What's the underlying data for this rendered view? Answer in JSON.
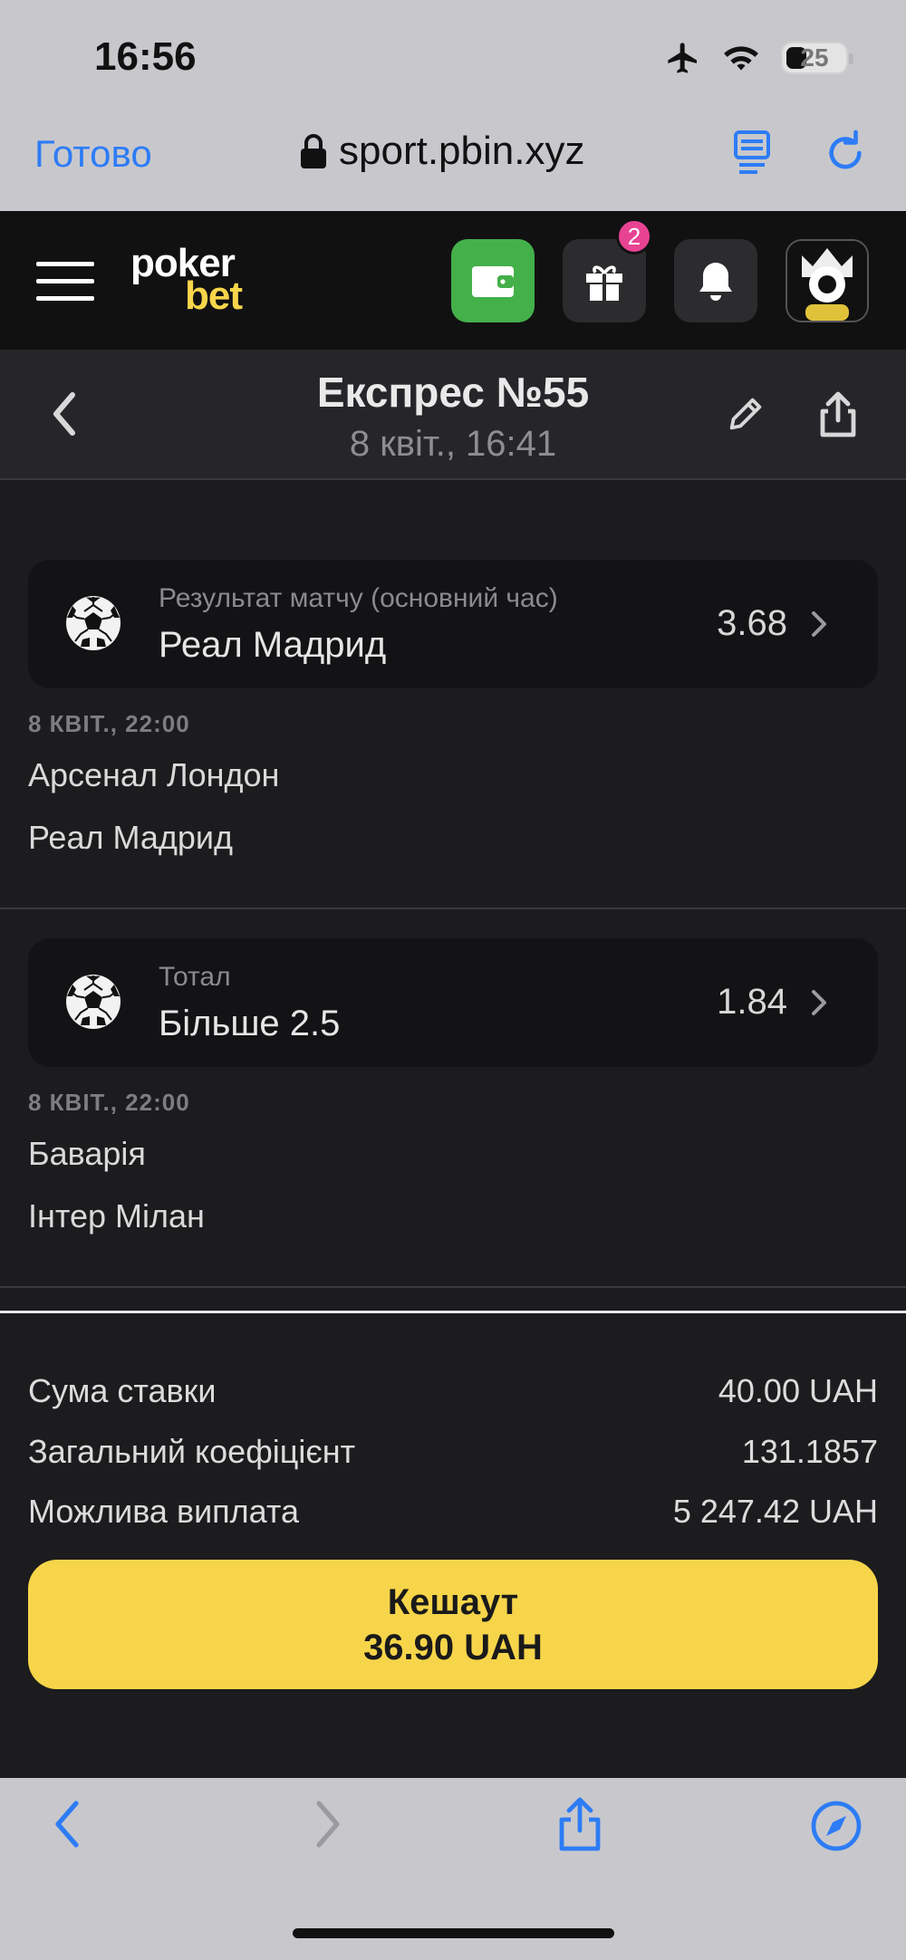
{
  "status": {
    "time": "16:56",
    "battery": "25"
  },
  "safari": {
    "done_label": "Готово",
    "url": "sport.pbin.xyz"
  },
  "header": {
    "logo_line1": "poker",
    "logo_line2": "bet",
    "gift_badge": "2",
    "wallet_color": "#44b04a",
    "accent_color": "#f7d54a"
  },
  "title_bar": {
    "title": "Експрес №55",
    "subtitle": "8 квіт., 16:41"
  },
  "bets": [
    {
      "market": "Результат матчу (основний час)",
      "selection": "Реал Мадрид",
      "odds": "3.68",
      "date": "8 КВІТ., 22:00",
      "team1": "Арсенал Лондон",
      "team2": "Реал Мадрид"
    },
    {
      "market": "Тотал",
      "selection": "Більше 2.5",
      "odds": "1.84",
      "date": "8 КВІТ., 22:00",
      "team1": "Баварія",
      "team2": "Інтер Мілан"
    }
  ],
  "summary": {
    "stake_label": "Сума ставки",
    "stake_value": "40.00 UAH",
    "coef_label": "Загальний коефіцієнт",
    "coef_value": "131.1857",
    "payout_label": "Можлива виплата",
    "payout_value": "5 247.42 UAH"
  },
  "cashout": {
    "label": "Кешаут",
    "amount": "36.90 UAH"
  }
}
